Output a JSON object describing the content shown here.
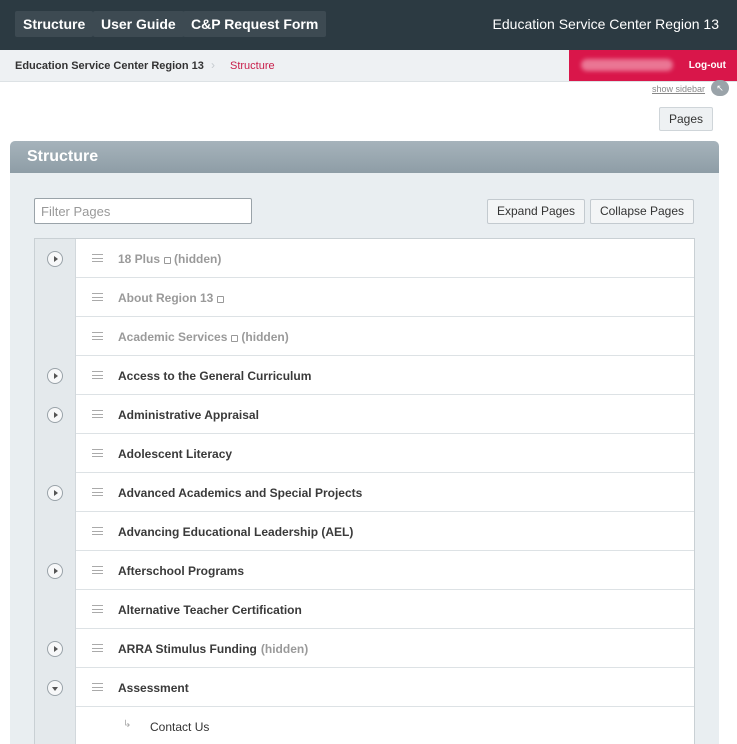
{
  "topbar": {
    "nav": [
      "Structure",
      "User Guide",
      "C&P Request Form"
    ],
    "site_title": "Education Service Center Region 13"
  },
  "breadcrumb": {
    "home": "Education Service Center Region 13",
    "separator": "›",
    "current": "Structure"
  },
  "user": {
    "logout": "Log-out"
  },
  "sidebar": {
    "show_label": "show sidebar"
  },
  "pages_button": "Pages",
  "panel": {
    "title": "Structure",
    "filter_placeholder": "Filter Pages",
    "expand_label": "Expand Pages",
    "collapse_label": "Collapse Pages"
  },
  "hidden_label": "(hidden)",
  "rows": [
    {
      "title": "18 Plus",
      "toggle": "closed",
      "muted": true,
      "lock": true,
      "hidden": true
    },
    {
      "title": "About Region 13",
      "toggle": "none",
      "muted": true,
      "lock": true,
      "hidden": false
    },
    {
      "title": "Academic Services",
      "toggle": "none",
      "muted": true,
      "lock": true,
      "hidden": true
    },
    {
      "title": "Access to the General Curriculum",
      "toggle": "closed",
      "muted": false,
      "lock": false,
      "hidden": false
    },
    {
      "title": "Administrative Appraisal",
      "toggle": "closed",
      "muted": false,
      "lock": false,
      "hidden": false
    },
    {
      "title": "Adolescent Literacy",
      "toggle": "none",
      "muted": false,
      "lock": false,
      "hidden": false
    },
    {
      "title": "Advanced Academics and Special Projects",
      "toggle": "closed",
      "muted": false,
      "lock": false,
      "hidden": false
    },
    {
      "title": "Advancing Educational Leadership (AEL)",
      "toggle": "none",
      "muted": false,
      "lock": false,
      "hidden": false
    },
    {
      "title": "Afterschool Programs",
      "toggle": "closed",
      "muted": false,
      "lock": false,
      "hidden": false
    },
    {
      "title": "Alternative Teacher Certification",
      "toggle": "none",
      "muted": false,
      "lock": false,
      "hidden": false
    },
    {
      "title": "ARRA Stimulus Funding",
      "toggle": "closed",
      "muted": false,
      "lock": false,
      "hidden": true
    },
    {
      "title": "Assessment",
      "toggle": "open",
      "muted": false,
      "lock": false,
      "hidden": false
    }
  ],
  "child_rows": [
    {
      "title": "Contact Us"
    }
  ],
  "colors": {
    "topbar": "#2c3a42",
    "accent": "#d9164a",
    "panel_header": "#8e9da6"
  }
}
